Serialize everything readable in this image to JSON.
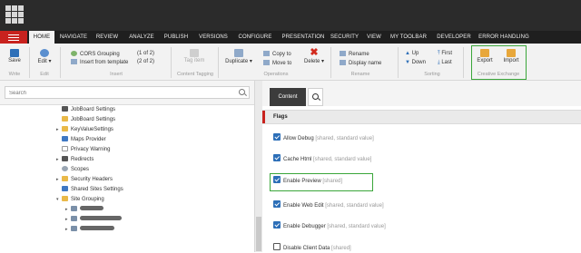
{
  "tabs": [
    {
      "label": "HOME",
      "active": true
    },
    {
      "label": "NAVIGATE"
    },
    {
      "label": "REVIEW"
    },
    {
      "label": "ANALYZE"
    },
    {
      "label": "PUBLISH"
    },
    {
      "label": "VERSIONS"
    },
    {
      "label": "CONFIGURE"
    },
    {
      "label": "PRESENTATION"
    },
    {
      "label": "SECURITY"
    },
    {
      "label": "VIEW"
    },
    {
      "label": "MY TOOLBAR"
    },
    {
      "label": "DEVELOPER"
    },
    {
      "label": "ERROR HANDLING"
    }
  ],
  "ribbon": {
    "save": "Save",
    "write_group": "Write",
    "edit": "Edit",
    "edit_group": "Edit",
    "cors_grouping": "CORS Grouping",
    "cors_count": "(1 of 2)",
    "insert_from_template": "Insert from template",
    "insert_count": "(2 of 2)",
    "insert_group": "Insert",
    "tag_item": "Tag item",
    "tagging_group": "Content Tagging",
    "duplicate": "Duplicate",
    "copy_to": "Copy to",
    "move_to": "Move to",
    "delete": "Delete",
    "operations_group": "Operations",
    "rename": "Rename",
    "display_name": "Display name",
    "rename_group": "Rename",
    "up": "Up",
    "down": "Down",
    "first": "First",
    "last": "Last",
    "sorting_group": "Sorting",
    "export": "Export",
    "import": "Import",
    "creative_exchange_group": "Creative Exchange"
  },
  "search": {
    "placeholder": "Search"
  },
  "tree": [
    {
      "label": "JobBoard Settings"
    },
    {
      "label": "JobBoard Settings"
    },
    {
      "label": "KeyValueSettings"
    },
    {
      "label": "Maps Provider"
    },
    {
      "label": "Privacy Warning"
    },
    {
      "label": "Redirects"
    },
    {
      "label": "Scopes"
    },
    {
      "label": "Security Headers"
    },
    {
      "label": "Shared Sites Settings"
    },
    {
      "label": "Site Grouping"
    }
  ],
  "content": {
    "tab_content": "Content",
    "section_title": "Flags",
    "fields": [
      {
        "label": "Allow Debug",
        "meta": "[shared, standard value]",
        "checked": true
      },
      {
        "label": "Cache Html",
        "meta": "[shared, standard value]",
        "checked": true
      },
      {
        "label": "Enable Preview",
        "meta": "[shared]",
        "checked": true
      },
      {
        "label": "Enable Web Edit",
        "meta": "[shared, standard value]",
        "checked": true
      },
      {
        "label": "Enable Debugger",
        "meta": "[shared, standard value]",
        "checked": true
      },
      {
        "label": "Disable Client Data",
        "meta": "[shared]",
        "checked": false
      }
    ]
  },
  "colors": {
    "accent_red": "#c8221e",
    "highlight_green": "#3aa63a",
    "checkbox_blue": "#2d6fb8"
  }
}
